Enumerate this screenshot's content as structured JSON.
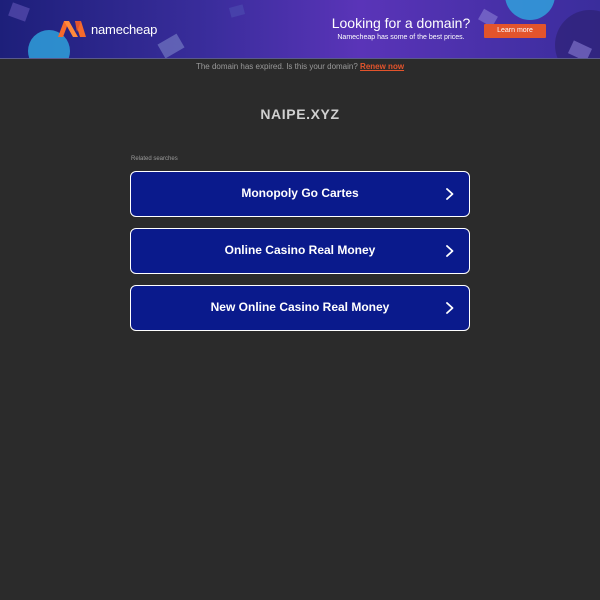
{
  "banner": {
    "brand_name": "namecheap",
    "promo_title": "Looking for a domain?",
    "promo_subtitle": "Namecheap has some of the best prices.",
    "cta_label": "Learn more",
    "accent_color": "#e3542c"
  },
  "notice": {
    "text": "The domain has expired. Is this your domain?",
    "link_label": "Renew now"
  },
  "domain": {
    "name": "NAIPE.XYZ"
  },
  "related": {
    "label": "Related searches",
    "items": [
      {
        "label": "Monopoly Go Cartes",
        "icon": "chevron-right-icon"
      },
      {
        "label": "Online Casino Real Money",
        "icon": "chevron-right-icon"
      },
      {
        "label": "New Online Casino Real Money",
        "icon": "chevron-right-icon"
      }
    ]
  },
  "colors": {
    "page_background": "#2b2b2b",
    "button_background": "#0a1a8c",
    "button_border": "#ffffff"
  }
}
